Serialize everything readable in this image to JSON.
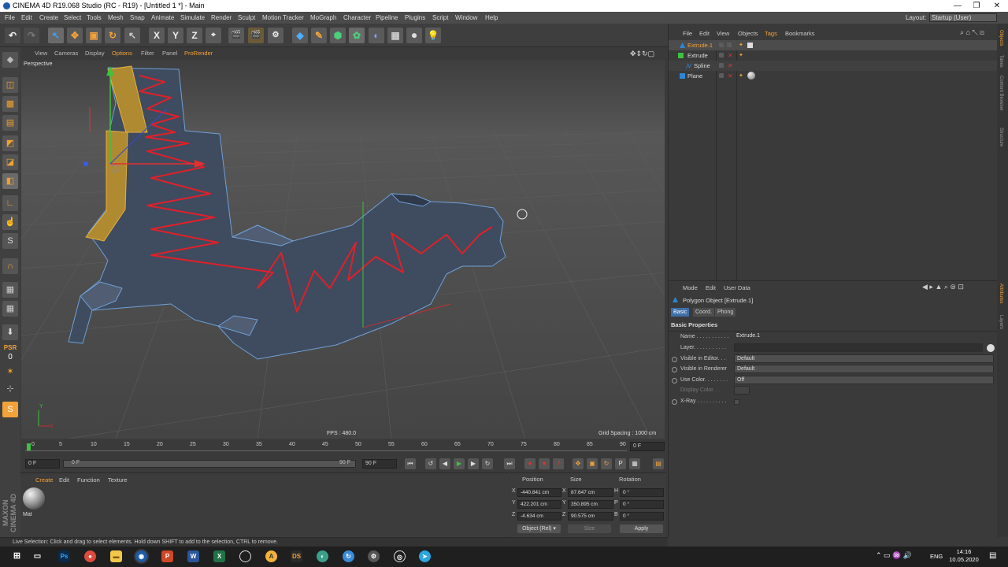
{
  "window": {
    "title": "CINEMA 4D R19.068 Studio (RC - R19) - [Untitled 1 *] - Main",
    "min": "—",
    "max": "❐",
    "close": "✕"
  },
  "menu": [
    "File",
    "Edit",
    "Create",
    "Select",
    "Tools",
    "Mesh",
    "Snap",
    "Animate",
    "Simulate",
    "Render",
    "Sculpt",
    "Motion Tracker",
    "MoGraph",
    "Character",
    "Pipeline",
    "Plugins",
    "Script",
    "Window",
    "Help"
  ],
  "layout": {
    "label": "Layout:",
    "value": "Startup (User)"
  },
  "viewport": {
    "menu": [
      "View",
      "Cameras",
      "Display",
      "Options",
      "Filter",
      "Panel",
      "ProRender"
    ],
    "active_menu": "Options",
    "camera": "Perspective",
    "fps": "FPS : 480.0",
    "grid_spacing": "Grid Spacing : 1000 cm",
    "axis_y": "Y",
    "axis_x": "X"
  },
  "timeline": {
    "ticks": [
      "0",
      "5",
      "10",
      "15",
      "20",
      "25",
      "30",
      "35",
      "40",
      "45",
      "50",
      "55",
      "60",
      "65",
      "70",
      "75",
      "80",
      "85",
      "90"
    ],
    "current_frame": "0 F",
    "start": "0 F",
    "slider_start": "0 F",
    "slider_end": "90 F",
    "end": "90 F"
  },
  "material_manager": {
    "menu": [
      "Create",
      "Edit",
      "Function",
      "Texture"
    ],
    "active": "Create",
    "material_name": "Mat"
  },
  "coordinates": {
    "headers": [
      "Position",
      "Size",
      "Rotation"
    ],
    "rows": [
      {
        "axis": "X",
        "pos": "-440.841 cm",
        "size_axis": "X",
        "size": "87.647 cm",
        "rot_axis": "H",
        "rot": "0 °"
      },
      {
        "axis": "Y",
        "pos": "422.201 cm",
        "size_axis": "Y",
        "size": "350.895 cm",
        "rot_axis": "P",
        "rot": "0 °"
      },
      {
        "axis": "Z",
        "pos": "-4.634 cm",
        "size_axis": "Z",
        "size": "90.575 cm",
        "rot_axis": "B",
        "rot": "0 °"
      }
    ],
    "mode": "Object (Rel) ▾",
    "size_mode": "Size",
    "apply": "Apply"
  },
  "maxon": "MAXON CINEMA 4D",
  "status": "Live Selection: Click and drag to select elements. Hold down SHIFT to add to the selection, CTRL to remove.",
  "object_manager": {
    "menu": [
      "File",
      "Edit",
      "View",
      "Objects",
      "Tags",
      "Bookmarks"
    ],
    "active": "Tags",
    "objects": [
      {
        "name": "Extrude.1",
        "selected": true
      },
      {
        "name": "Extrude",
        "selected": false
      },
      {
        "name": "Spline",
        "selected": false
      },
      {
        "name": "Plane",
        "selected": false
      }
    ]
  },
  "attributes": {
    "menu": [
      "Mode",
      "Edit",
      "User Data"
    ],
    "object_title": "Polygon Object [Extrude.1]",
    "tabs": [
      "Basic",
      "Coord.",
      "Phong"
    ],
    "active_tab": "Basic",
    "section": "Basic Properties",
    "fields": [
      {
        "label": "Name . . . . . . . . . . .",
        "value": "Extrude.1"
      },
      {
        "label": "Layer. . . . . . . . . . .",
        "value": ""
      },
      {
        "label": "Visible in Editor. . .",
        "value": "Default"
      },
      {
        "label": "Visible in Renderer",
        "value": "Default"
      },
      {
        "label": "Use Color. . . . . . . .",
        "value": "Off"
      },
      {
        "label": "Display Color. . .",
        "value": ""
      },
      {
        "label": "X-Ray . . . . . . . . . .",
        "value": ""
      }
    ]
  },
  "side_tabs": [
    "Objects",
    "Takes",
    "Content Browser",
    "Structure",
    "Attributes",
    "Layers"
  ],
  "taskbar": {
    "lang": "ENG",
    "time": "14:16",
    "date": "10.05.2020"
  },
  "colors": {
    "selection": "#f3a23a",
    "spline": "#e0202a",
    "mesh": "#3f4b5e",
    "edges": "#6fa0d8"
  }
}
